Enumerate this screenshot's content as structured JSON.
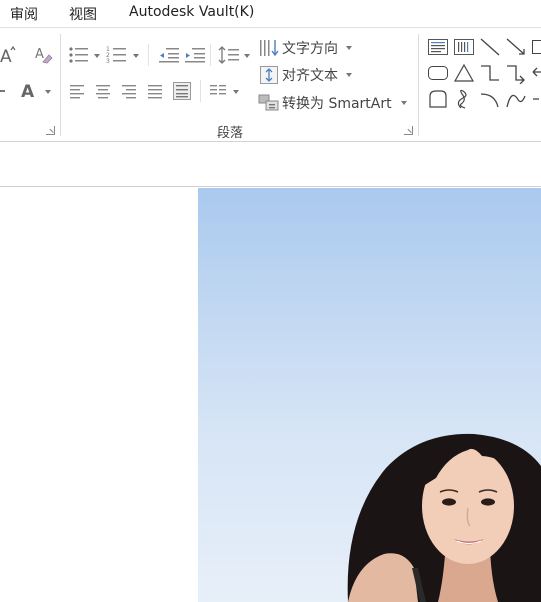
{
  "menubar": {
    "items": [
      {
        "label": "审阅"
      },
      {
        "label": "视图"
      },
      {
        "label": "Autodesk Vault(K)"
      }
    ]
  },
  "ribbon": {
    "paragraph_group": {
      "label": "段落",
      "text_direction_label": "文字方向",
      "align_text_label": "对齐文本",
      "smartart_label": "转换为 SmartArt"
    }
  },
  "colors": {
    "sky_top": "#a9c9ee",
    "sky_bottom": "#e7eff9",
    "icon_gray": "#666666"
  }
}
